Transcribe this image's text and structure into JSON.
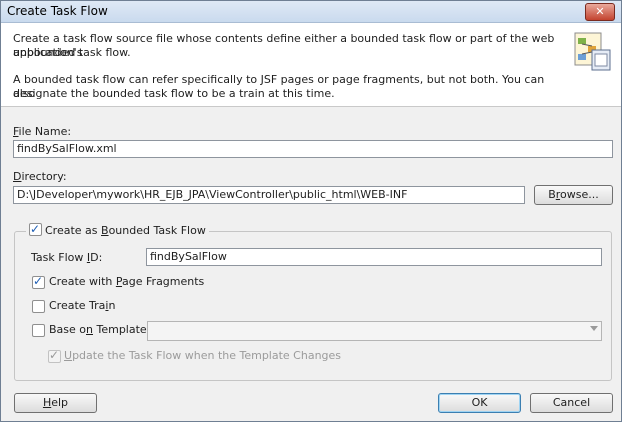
{
  "window": {
    "title": "Create Task Flow",
    "close_glyph": "✕"
  },
  "header": {
    "line1": "Create a task flow source file whose contents define either a bounded task flow or part of the web application's",
    "line2": "unbounded task flow.",
    "line3": "A bounded task flow can refer specifically to JSF pages or page fragments, but not both.  You can also",
    "line4": "designate the bounded task flow to be a train at this time.",
    "icon": "task-flow-icon"
  },
  "file_name": {
    "label_mnemonic": "F",
    "label_rest": "ile Name:",
    "value": "findBySalFlow.xml"
  },
  "directory": {
    "label_mnemonic": "D",
    "label_rest": "irectory:",
    "value": "D:\\JDeveloper\\mywork\\HR_EJB_JPA\\ViewController\\public_html\\WEB-INF",
    "browse_pre": "B",
    "browse_mnemonic": "r",
    "browse_rest": "owse..."
  },
  "bounded": {
    "label_pre": "Create as ",
    "label_mnemonic": "B",
    "label_rest": "ounded Task Flow",
    "checked": true,
    "task_flow_id_pre": "Task Flow ",
    "task_flow_id_mnemonic": "I",
    "task_flow_id_rest": "D:",
    "task_flow_id_value": "findBySalFlow",
    "page_fragments_pre": "Create with ",
    "page_fragments_mnemonic": "P",
    "page_fragments_rest": "age Fragments",
    "page_fragments_checked": true,
    "train_pre": "Create Tra",
    "train_mnemonic": "i",
    "train_rest": "n",
    "train_checked": false,
    "template_pre": "Base o",
    "template_mnemonic": "n",
    "template_rest": " Template:",
    "template_checked": false,
    "template_value": "",
    "update_mnemonic": "U",
    "update_rest": "pdate the Task Flow when the Template Changes",
    "update_checked": true
  },
  "buttons": {
    "help_mnemonic": "H",
    "help_rest": "elp",
    "ok": "OK",
    "cancel": "Cancel"
  }
}
